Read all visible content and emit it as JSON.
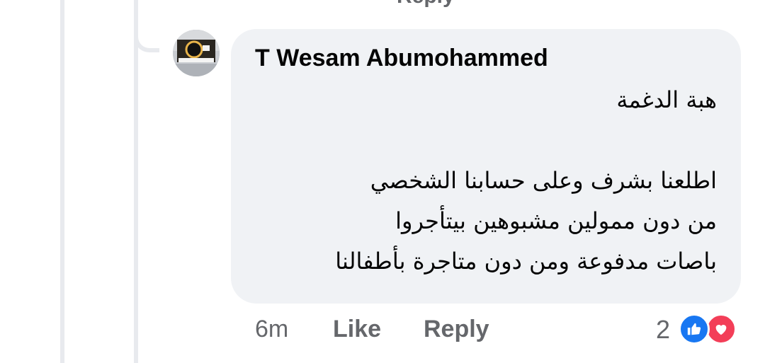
{
  "previous_reply_fragment": "Reply",
  "comment": {
    "author": "T Wesam Abumohammed",
    "avatar_icon": "profile-photo-icon",
    "body_lines": [
      "هبة الدغمة",
      "",
      "اطلعنا بشرف وعلى حسابنا الشخصي",
      "من دون ممولين مشبوهين بيتأجروا",
      "باصات مدفوعة ومن دون متاجرة بأطفالنا"
    ],
    "timestamp": "6m",
    "like_label": "Like",
    "reply_label": "Reply",
    "reactions": {
      "count": "2",
      "types": [
        "like-icon",
        "love-icon"
      ]
    }
  },
  "colors": {
    "bubble": "#f0f2f5",
    "thread_line": "#e8eaee",
    "secondary_text": "#65676b",
    "like_blue": "#1877f2",
    "love_red": "#f33e58"
  }
}
